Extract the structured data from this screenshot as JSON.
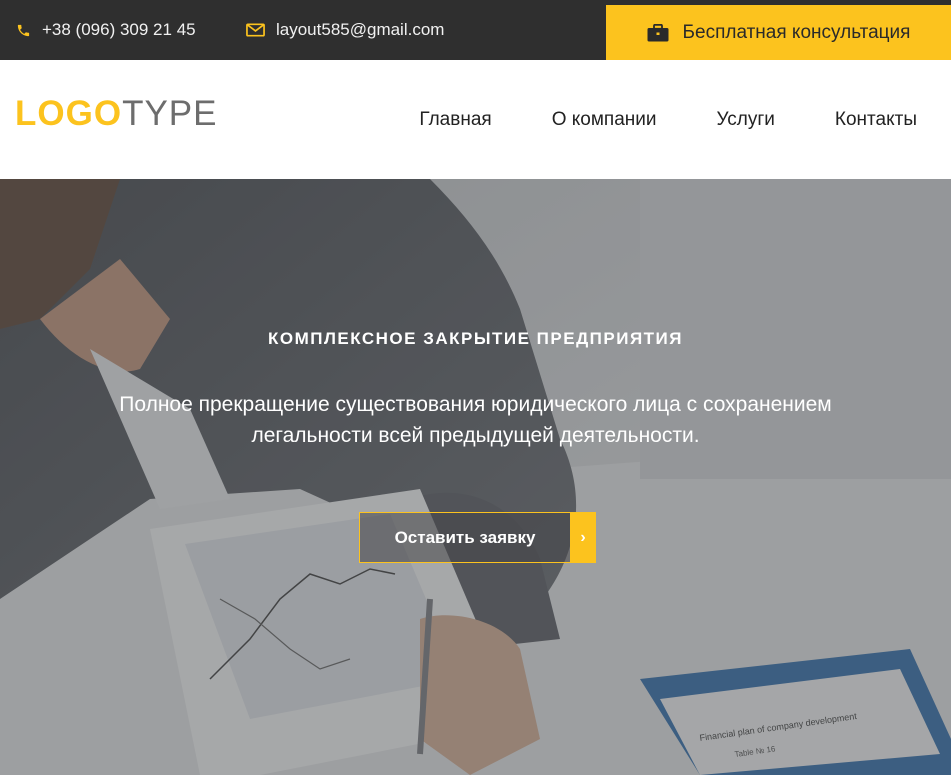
{
  "topbar": {
    "phone": "+38 (096) 309 21 45",
    "phone_icon": "phone-icon",
    "email": "layout585@gmail.com",
    "email_icon": "envelope-icon",
    "consult_label": "Бесплатная консультация",
    "consult_icon": "briefcase-icon"
  },
  "header": {
    "logo_part1": "LOGO",
    "logo_part2": "TYPE",
    "nav": [
      {
        "label": "Главная"
      },
      {
        "label": "О компании"
      },
      {
        "label": "Услуги"
      },
      {
        "label": "Контакты"
      }
    ]
  },
  "hero": {
    "title": "КОМПЛЕКСНОЕ ЗАКРЫТИЕ ПРЕДПРИЯТИЯ",
    "subtitle": "Полное прекращение существования юридического лица с сохранением легальности всей предыдущей деятельности.",
    "button_label": "Оставить заявку",
    "button_icon": "chevron-right-icon",
    "bg_doc_text_1": "Financial plan of company development",
    "bg_doc_text_2": "Table № 16"
  },
  "colors": {
    "accent": "#fcc31e",
    "topbar_bg": "#2f2f2f",
    "text_dark": "#222222",
    "logo_gray": "#6d6d6d"
  }
}
